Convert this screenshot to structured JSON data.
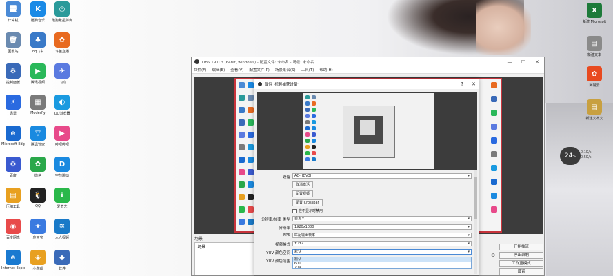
{
  "desktop": {
    "icons": [
      {
        "label": "计算机",
        "color": "#4a8ad6",
        "glyph": "🖥"
      },
      {
        "label": "酷狗音乐",
        "color": "#1a8ae6",
        "glyph": "K"
      },
      {
        "label": "酷狗繁星伴奏",
        "color": "#2a9a9a",
        "glyph": "◎"
      },
      {
        "label": "回收站",
        "color": "#6a8ab0",
        "glyph": "🗑"
      },
      {
        "label": "qq飞车",
        "color": "#3a7ac8",
        "glyph": "♣"
      },
      {
        "label": "斗鱼直播",
        "color": "#e86a20",
        "glyph": "✿"
      },
      {
        "label": "控制面板",
        "color": "#3a6ab8",
        "glyph": "⚙"
      },
      {
        "label": "腾讯视频",
        "color": "#2ab85a",
        "glyph": "▶"
      },
      {
        "label": "飞鸽",
        "color": "#5a7ae0",
        "glyph": "✈"
      },
      {
        "label": "迅雷",
        "color": "#2a6ae0",
        "glyph": "⚡"
      },
      {
        "label": "Moderfly",
        "color": "#7a7a7a",
        "glyph": "▦"
      },
      {
        "label": "QQ浏览器",
        "color": "#1a9ae0",
        "glyph": "◐"
      },
      {
        "label": "Microsoft Edge",
        "color": "#1a6ad0",
        "glyph": "e"
      },
      {
        "label": "腾讯管家",
        "color": "#1a8ae0",
        "glyph": "▽"
      },
      {
        "label": "哔哩哔哩",
        "color": "#e84a8a",
        "glyph": "▶"
      },
      {
        "label": "百度",
        "color": "#3a5ad0",
        "glyph": "⚙"
      },
      {
        "label": "微信",
        "color": "#2aa84a",
        "glyph": "✿"
      },
      {
        "label": "字节跳动",
        "color": "#1a8ae0",
        "glyph": "D"
      },
      {
        "label": "压缩工具",
        "color": "#e8a020",
        "glyph": "▤"
      },
      {
        "label": "QQ",
        "color": "#222222",
        "glyph": "🐧"
      },
      {
        "label": "爱奇艺",
        "color": "#2ab84a",
        "glyph": "i"
      },
      {
        "label": "百度网盘",
        "color": "#e84a4a",
        "glyph": "◉"
      },
      {
        "label": "应用宝",
        "color": "#3a7ae0",
        "glyph": "★"
      },
      {
        "label": "人人视频",
        "color": "#1a7ac8",
        "glyph": "≋"
      },
      {
        "label": "Internet Explorer",
        "color": "#1a7ad0",
        "glyph": "e"
      },
      {
        "label": "小游戏",
        "color": "#e8a020",
        "glyph": "◈"
      },
      {
        "label": "软件",
        "color": "#3a6ab8",
        "glyph": "◆"
      }
    ],
    "right_icons": [
      {
        "label": "新建 Microsoft",
        "color": "#1d7a3a",
        "glyph": "X"
      },
      {
        "label": "新建文本",
        "color": "#8a8a8a",
        "glyph": "▤"
      },
      {
        "label": "网易云",
        "color": "#e84a20",
        "glyph": "✿"
      },
      {
        "label": "新建文本文",
        "color": "#c8a040",
        "glyph": "▤"
      }
    ],
    "clock_big": "24",
    "clock_small": "%",
    "clock_sub1": "0.1K/s",
    "clock_sub2": "0.5K/s"
  },
  "obs": {
    "title": "OBS 19.0.3 (64bit, windows) - 配置文件: 未命名 - 场景: 未命名",
    "menu": [
      "文件(F)",
      "编辑(E)",
      "查看(V)",
      "配置文件(P)",
      "场景集合(S)",
      "工具(T)",
      "帮助(H)"
    ],
    "scene_label": "场景",
    "scene_item": "场景",
    "buttons": {
      "start_stream": "开始推流",
      "stop_record": "停止录制",
      "studio_mode": "工作室模式",
      "settings": "设置"
    }
  },
  "props": {
    "title": "属性 '视频捕获设备'",
    "device_label": "设备",
    "device_value": "AC-HDV3H",
    "deactivate_btn": "取消激活",
    "configure_video_btn": "配置视频",
    "configure_crossbar_btn": "配置 Crossbar",
    "deactivate_hidden_label": "在不显示时禁用",
    "res_type_label": "分辨率/帧率 类型",
    "res_type_value": "自定义",
    "resolution_label": "分辨率",
    "resolution_value": "1920x1080",
    "fps_label": "FPS",
    "fps_value": "匹配输出帧率",
    "video_format_label": "视频格式",
    "video_format_value": "YUY2",
    "color_space_label": "YUV 颜色空间",
    "color_space_value": "默认",
    "color_range_label": "YUV 颜色范围",
    "dropdown_options": [
      "默认",
      "601",
      "709"
    ]
  }
}
